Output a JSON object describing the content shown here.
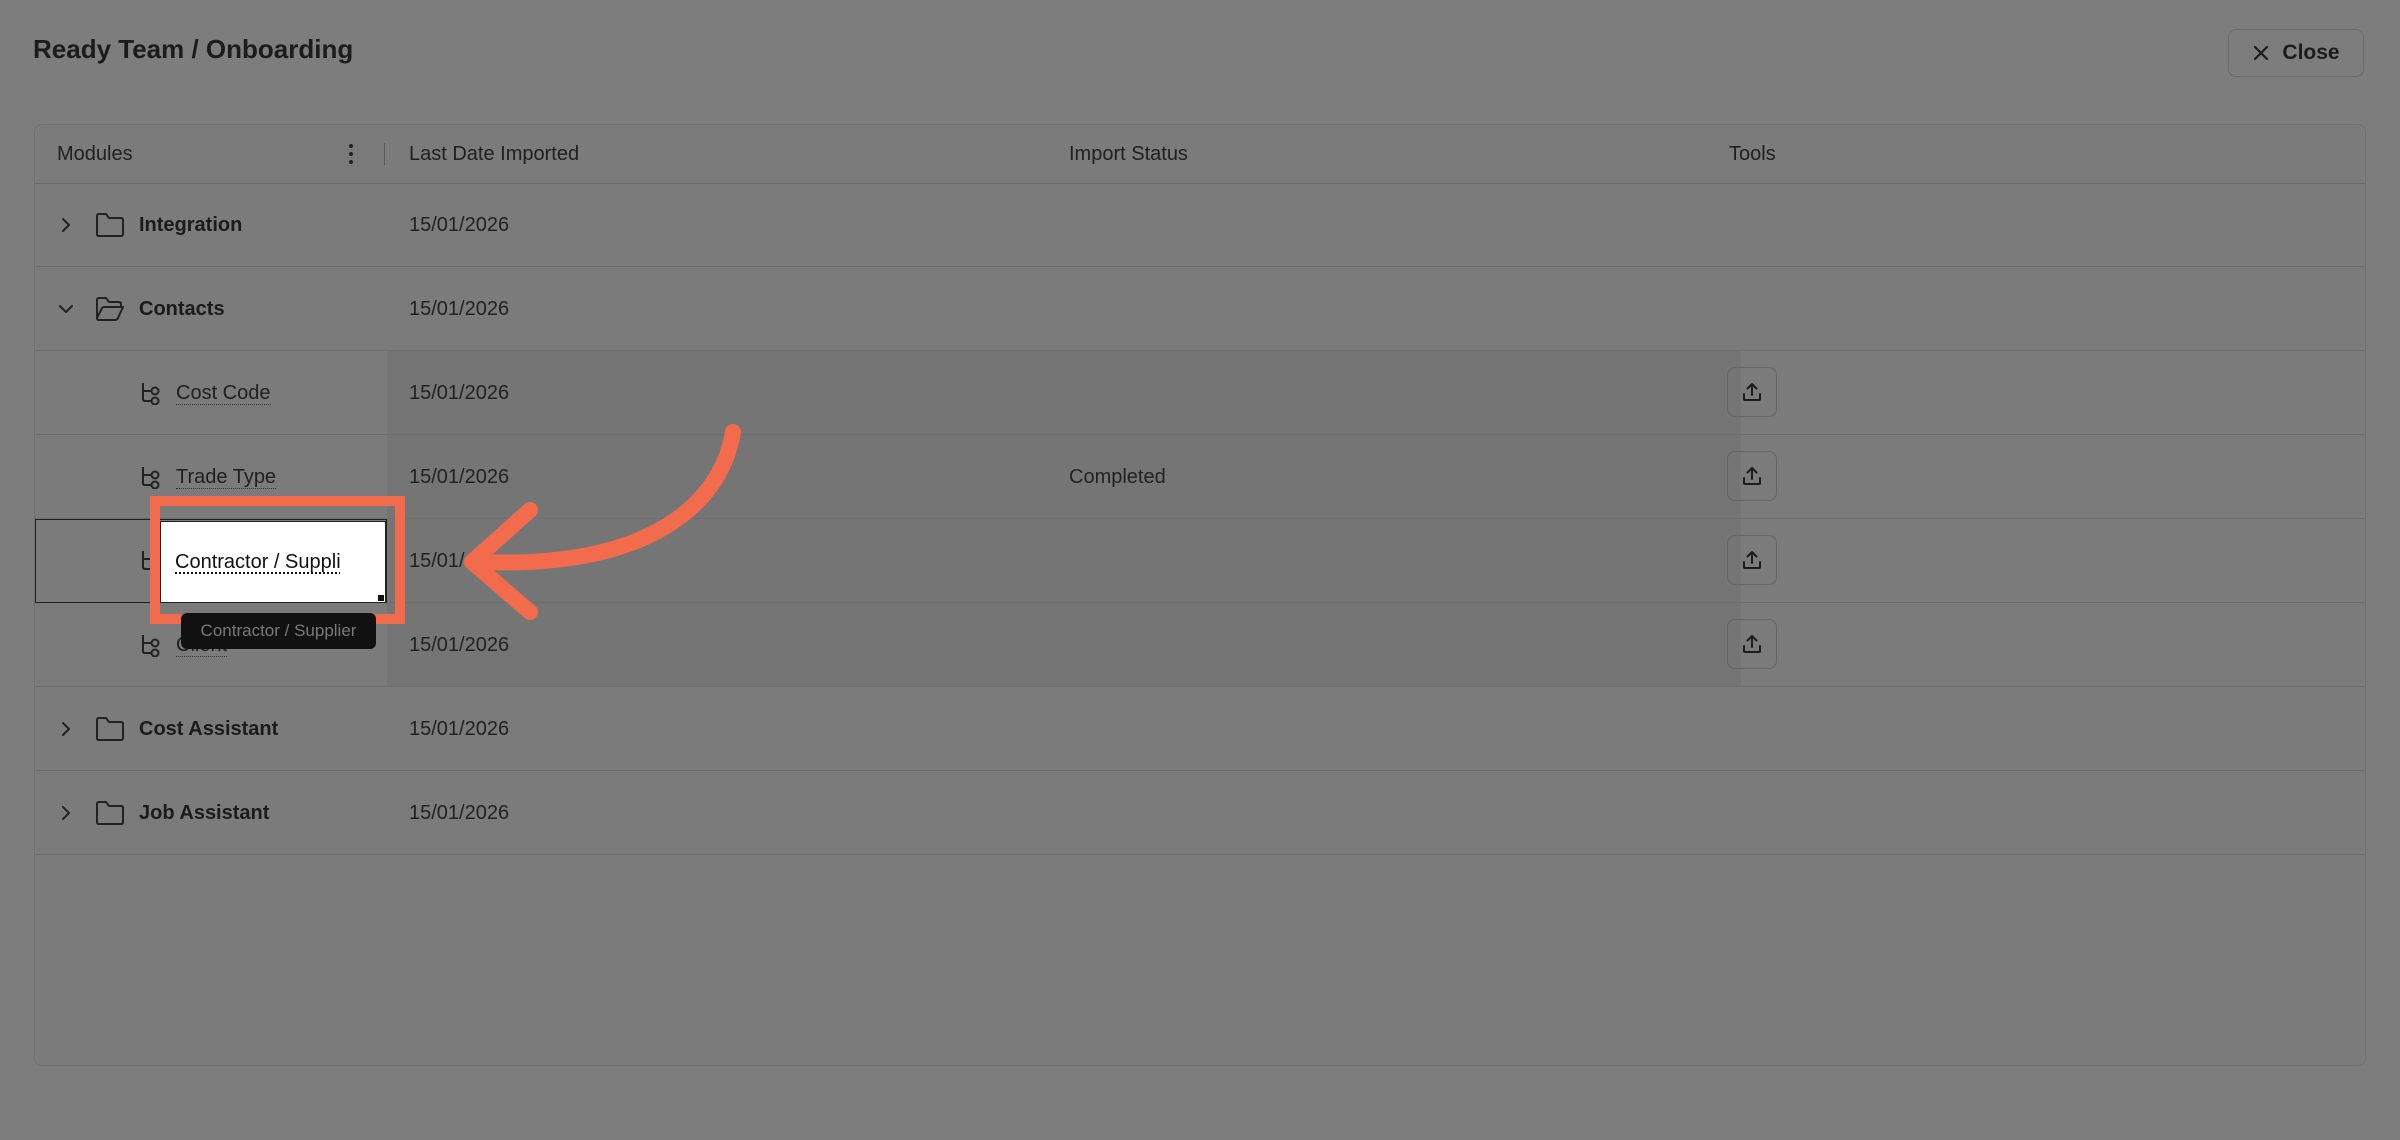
{
  "header": {
    "title": "Ready Team / Onboarding",
    "close_label": "Close"
  },
  "table": {
    "columns": [
      "Modules",
      "Last Date Imported",
      "Import Status",
      "Tools"
    ],
    "rows": [
      {
        "name": "Integration",
        "date": "15/01/2026",
        "status": "",
        "expanded": false
      },
      {
        "name": "Contacts",
        "date": "15/01/2026",
        "status": "",
        "expanded": true
      },
      {
        "name": "Cost Code",
        "date": "15/01/2026",
        "status": ""
      },
      {
        "name": "Trade Type",
        "date": "15/01/2026",
        "status": "Completed"
      },
      {
        "name": "Contractor / Supplier",
        "date": "15/01/",
        "status": ""
      },
      {
        "name": "Client",
        "date": "15/01/2026",
        "status": ""
      },
      {
        "name": "Cost Assistant",
        "date": "15/01/2026",
        "status": "",
        "expanded": false
      },
      {
        "name": "Job Assistant",
        "date": "15/01/2026",
        "status": "",
        "expanded": false
      }
    ]
  },
  "edit": {
    "value": "Contractor / Suppli",
    "tooltip": "Contractor / Supplier"
  },
  "colors": {
    "highlight": "#f26b4c",
    "overlay": "#7d7d7d"
  },
  "icons": [
    "close-icon",
    "more-vertical-icon",
    "chevron-right-icon",
    "chevron-down-icon",
    "folder-icon",
    "folder-open-icon",
    "tree-icon",
    "upload-icon"
  ]
}
